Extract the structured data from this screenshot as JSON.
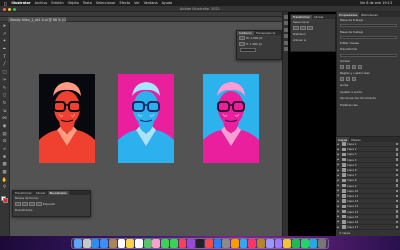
{
  "menubar": {
    "apple_icon": "apple-icon",
    "items": [
      "Illustrator",
      "Archivo",
      "Edición",
      "Objeto",
      "Texto",
      "Seleccionar",
      "Efecto",
      "Ver",
      "Ventana",
      "Ayuda"
    ],
    "right": [
      "Vie 8 de ene  19:13"
    ]
  },
  "window": {
    "title": "Adobe Illustrator 2021"
  },
  "document": {
    "tab_label": "Woody Allen_1_ok1.0.ai @ 66 % (CMYK/Previsualizar)"
  },
  "artboards": [
    {
      "label": "01",
      "bg": "#07090f",
      "ink": "#f04030",
      "light": "#ff9b80"
    },
    {
      "label": "02",
      "bg": "#ea1f9e",
      "ink": "#2cb0ee",
      "light": "#a8e4fb"
    },
    {
      "label": "03",
      "bg": "#2cb3ee",
      "ink": "#ea1f9e",
      "light": "#ff9bd5"
    }
  ],
  "transform_panel": {
    "tabs": [
      "Contorno",
      "Transparencia",
      "Apariencia"
    ],
    "rows": [
      "W: 1.000 pt",
      "H: 1.000 pt"
    ]
  },
  "float_panel_2": {
    "tabs": [
      "Transformar",
      "Alinear"
    ],
    "rows": [
      "Seleccionar",
      "Distribuir",
      "Alinear a:"
    ]
  },
  "pathfinder_panel": {
    "tabs": [
      "Transformar",
      "Alinear",
      "Buscatrazos"
    ],
    "rows": [
      "Modos de forma:",
      "Buscatrazos:"
    ],
    "expand_label": "Expandir"
  },
  "right_panel": {
    "tabs": [
      "Propiedades",
      "Bibliotecas"
    ],
    "sections": [
      "Mesa de trabajo",
      "Mesa de trabajo",
      "Transformar",
      "Alinear",
      "Reglas y cuadrículas",
      "Guías",
      "Ajustar a punto",
      "Preferencias"
    ],
    "buttons": [
      "Editar mesas",
      "Opciones del documento",
      "Preferencias"
    ]
  },
  "layers_panel": {
    "tabs": [
      "Capas",
      "Mesas"
    ],
    "layers": [
      "Capa 1",
      "Capa 2",
      "Capa 3",
      "Capa 4",
      "Capa 5",
      "Capa 6",
      "Capa 7",
      "Capa 8",
      "Capa 9",
      "Capa 10",
      "Capa 11",
      "Capa 12",
      "Capa 13",
      "Capa 14",
      "Capa 15",
      "Capa 16",
      "Capa 17"
    ],
    "footer": "3 capas"
  },
  "tools": [
    "selection-icon",
    "direct-selection-icon",
    "magic-wand-icon",
    "pen-icon",
    "type-icon",
    "line-icon",
    "rectangle-icon",
    "brush-icon",
    "pencil-icon",
    "eraser-icon",
    "rotate-icon",
    "scale-icon",
    "width-icon",
    "shape-builder-icon",
    "gradient-icon",
    "eyedropper-icon",
    "blend-icon",
    "symbol-icon",
    "graph-icon",
    "artboard-icon",
    "hand-icon",
    "zoom-icon"
  ],
  "dock_apps": [
    "finder",
    "launchpad",
    "safari",
    "mail",
    "contacts",
    "calendar",
    "notes",
    "reminders",
    "maps",
    "photos",
    "messages",
    "facetime",
    "music",
    "podcasts",
    "tv",
    "news",
    "app-store",
    "preferences",
    "illustrator",
    "photoshop",
    "indesign",
    "bridge",
    "after-effects",
    "premiere",
    "chrome",
    "spotify",
    "whatsapp",
    "telegram",
    "trash"
  ]
}
